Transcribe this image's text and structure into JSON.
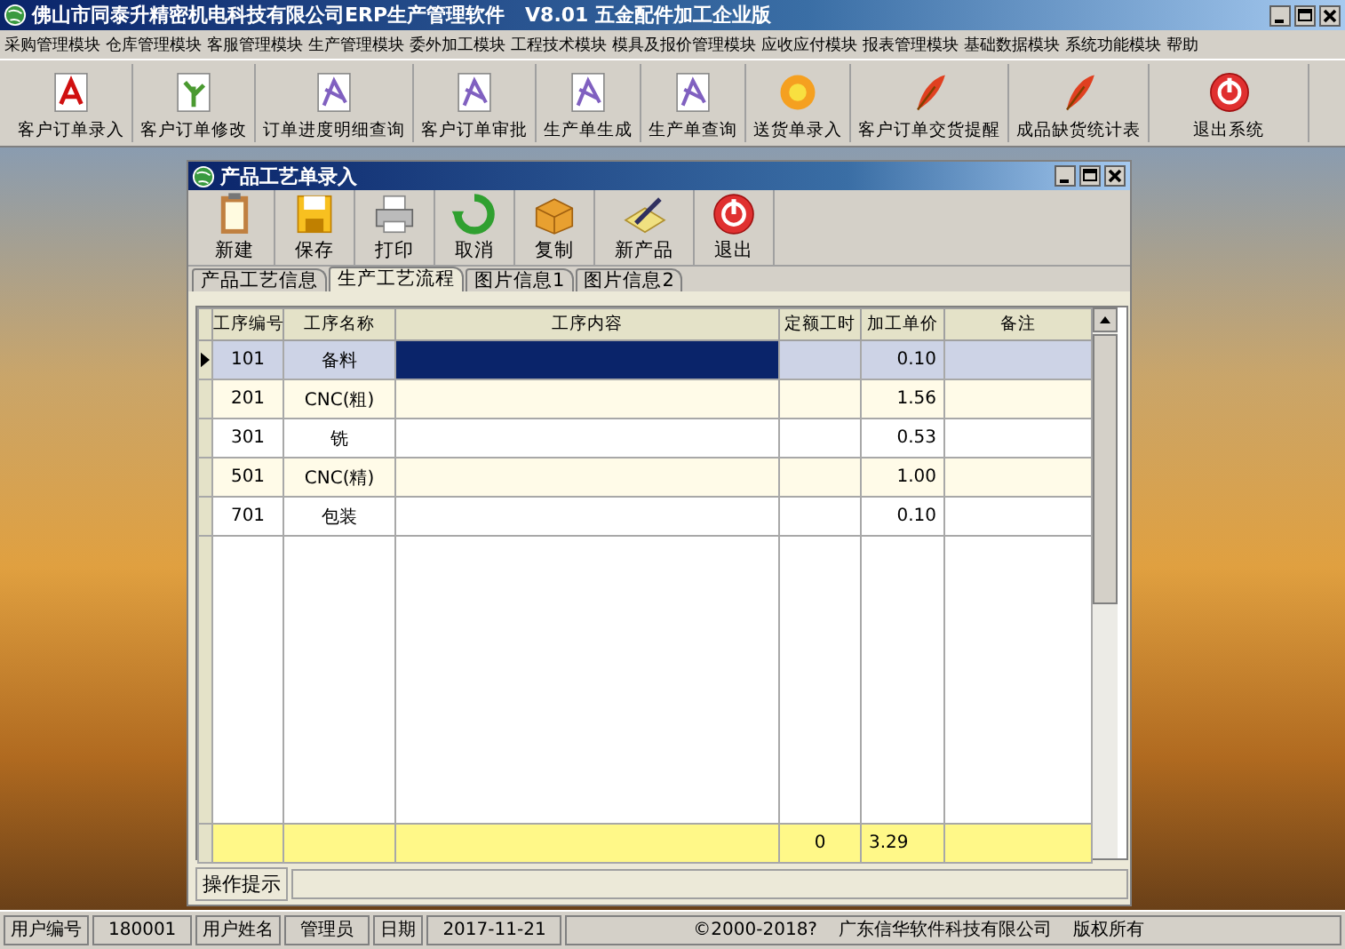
{
  "window": {
    "title": "佛山市同泰升精密机电科技有限公司ERP生产管理软件   V8.01 五金配件加工企业版"
  },
  "menu": [
    "采购管理模块",
    "仓库管理模块",
    "客服管理模块",
    "生产管理模块",
    "委外加工模块",
    "工程技术模块",
    "模具及报价管理模块",
    "应收应付模块",
    "报表管理模块",
    "基础数据模块",
    "系统功能模块",
    "帮助"
  ],
  "toolbar": [
    {
      "label": "客户订单录入",
      "kind": "pdf"
    },
    {
      "label": "客户订单修改",
      "kind": "plant"
    },
    {
      "label": "订单进度明细查询",
      "kind": "doc"
    },
    {
      "label": "客户订单审批",
      "kind": "doc"
    },
    {
      "label": "生产单生成",
      "kind": "doc"
    },
    {
      "label": "生产单查询",
      "kind": "doc"
    },
    {
      "label": "送货单录入",
      "kind": "flower"
    },
    {
      "label": "客户订单交货提醒",
      "kind": "feather"
    },
    {
      "label": "成品缺货统计表",
      "kind": "feather"
    },
    {
      "label": "退出系统",
      "kind": "power"
    }
  ],
  "child_window": {
    "title": "产品工艺单录入",
    "toolbar": [
      {
        "label": "新建",
        "kind": "clipboard"
      },
      {
        "label": "保存",
        "kind": "disk"
      },
      {
        "label": "打印",
        "kind": "printer"
      },
      {
        "label": "取消",
        "kind": "undo"
      },
      {
        "label": "复制",
        "kind": "box"
      },
      {
        "label": "新产品",
        "kind": "pen"
      },
      {
        "label": "退出",
        "kind": "power"
      }
    ],
    "tabs": [
      {
        "label": "产品工艺信息",
        "selected": false
      },
      {
        "label": "生产工艺流程",
        "selected": true
      },
      {
        "label": "图片信息1",
        "selected": false
      },
      {
        "label": "图片信息2",
        "selected": false
      }
    ],
    "table": {
      "columns": [
        {
          "label": "工序编号",
          "focused": false
        },
        {
          "label": "工序名称",
          "focused": false
        },
        {
          "label": "工序内容",
          "focused": true
        },
        {
          "label": "定额工时",
          "focused": false
        },
        {
          "label": "加工单价",
          "focused": false
        },
        {
          "label": "备注",
          "focused": false
        }
      ],
      "rows": [
        {
          "selected": true,
          "cells": [
            "101",
            "备料",
            null,
            null,
            "0.10",
            null
          ]
        },
        {
          "selected": false,
          "cells": [
            "201",
            "CNC(粗)",
            null,
            null,
            "1.56",
            null
          ]
        },
        {
          "selected": false,
          "cells": [
            "301",
            "铣",
            null,
            null,
            "0.53",
            null
          ]
        },
        {
          "selected": false,
          "cells": [
            "501",
            "CNC(精)",
            null,
            null,
            "1.00",
            null
          ]
        },
        {
          "selected": false,
          "cells": [
            "701",
            "包装",
            null,
            null,
            "0.10",
            null
          ]
        }
      ],
      "totals": {
        "quota_hours": "0",
        "unit_price": "3.29"
      }
    },
    "hint_bar": {
      "label": "操作提示"
    }
  },
  "status_bar": {
    "items": [
      {
        "kind": "label",
        "text": "用户编号"
      },
      {
        "kind": "value",
        "text": "180001"
      },
      {
        "kind": "label",
        "text": "用户姓名"
      },
      {
        "kind": "value",
        "text": "管理员"
      },
      {
        "kind": "label",
        "text": "日期"
      },
      {
        "kind": "value",
        "text": "2017-11-21"
      }
    ],
    "copyright": [
      "©2000-2018?",
      "广东信华软件科技有限公司",
      "版权所有"
    ]
  }
}
